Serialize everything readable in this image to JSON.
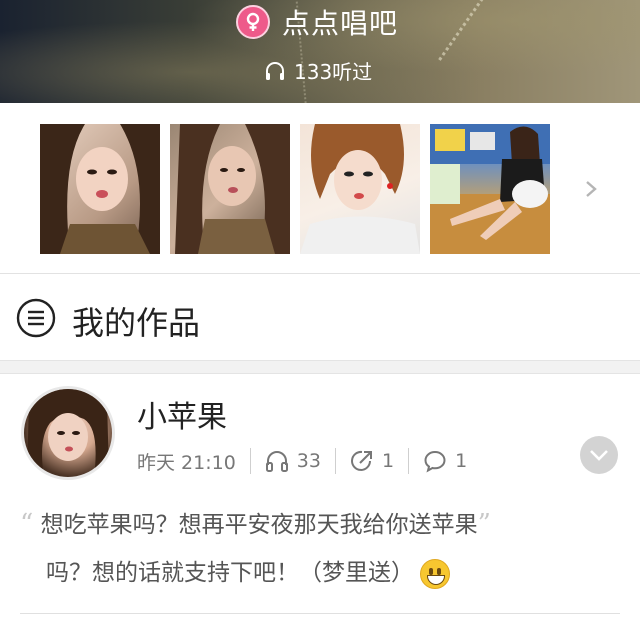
{
  "header": {
    "gender_icon": "female-icon",
    "name": "点点唱吧",
    "listen_icon": "headphones-icon",
    "listen_text": "133听过"
  },
  "photos": {
    "items": [
      {
        "name": "photo-1"
      },
      {
        "name": "photo-2"
      },
      {
        "name": "photo-3"
      },
      {
        "name": "photo-4"
      }
    ],
    "more_icon": "chevron-right-icon"
  },
  "section": {
    "icon": "menu-icon",
    "title": "我的作品"
  },
  "post": {
    "username": "小苹果",
    "time": "昨天 21:10",
    "listens": "33",
    "shares": "1",
    "comments": "1",
    "quote_open": "“",
    "quote_close": "”",
    "text_line1": "想吃苹果吗？想再平安夜那天我给你送苹果",
    "text_line2": "吗？想的话就支持下吧！（梦里送）",
    "emoji": "grin-emoji",
    "expand_icon": "chevron-down-icon"
  },
  "colors": {
    "accent_pink": "#ee5a8a",
    "text_primary": "#222222",
    "text_secondary": "#777777"
  }
}
